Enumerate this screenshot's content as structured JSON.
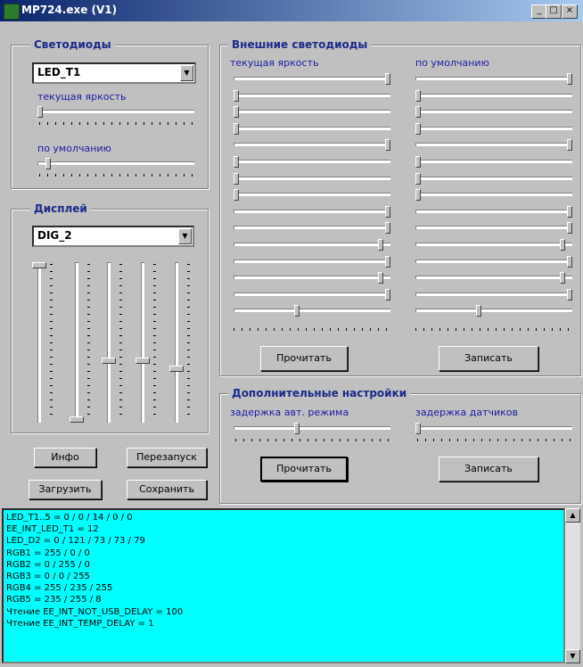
{
  "window": {
    "title": "MP724.exe (V1)",
    "controls": [
      "_",
      "□",
      "×"
    ]
  },
  "leds": {
    "title": "Светодиоды",
    "select_value": "LED_T1",
    "current_label": "текущая яркость",
    "current_value_fraction": 0.0,
    "default_label": "по умолчанию",
    "default_value_fraction": 0.05
  },
  "display": {
    "title": "Дисплей",
    "select_value": "DIG_2",
    "sliders_fraction": [
      0.0,
      1.0,
      0.62,
      0.62,
      0.67
    ]
  },
  "external": {
    "title": "Внешние светодиоды",
    "current_label": "текущая яркость",
    "default_label": "по умолчанию",
    "current_values_fraction": [
      1.0,
      0.0,
      0.0,
      0.0,
      1.0,
      0.0,
      0.0,
      0.0,
      1.0,
      1.0,
      0.95,
      1.0,
      0.95,
      1.0,
      0.4
    ],
    "default_values_fraction": [
      1.0,
      0.0,
      0.0,
      0.0,
      1.0,
      0.0,
      0.0,
      0.0,
      1.0,
      1.0,
      0.95,
      1.0,
      0.95,
      1.0,
      0.4
    ],
    "read_button": "Прочитать",
    "write_button": "Записать"
  },
  "extra": {
    "title": "Дополнительные настройки",
    "auto_delay_label": "задержка авт. режима",
    "auto_delay_fraction": 0.4,
    "sensor_delay_label": "задержка датчиков",
    "sensor_delay_fraction": 0.0,
    "read_button": "Прочитать",
    "write_button": "Записать"
  },
  "buttons": {
    "info": "Инфо",
    "restart": "Перезапуск",
    "load": "Загрузить",
    "save": "Сохранить"
  },
  "log_lines": [
    "LED_T1..5 = 0 / 0 / 14 / 0 / 0",
    "EE_INT_LED_T1 = 12",
    "LED_D2 = 0 / 121 / 73 / 73 / 79",
    "RGB1 = 255 / 0 / 0",
    "RGB2 = 0 / 255 / 0",
    "RGB3 = 0 / 0 / 255",
    "RGB4 = 255 / 235 / 255",
    "RGB5 = 235 / 255 / 8",
    "Чтение EE_INT_NOT_USB_DELAY = 100",
    "Чтение EE_INT_TEMP_DELAY = 1"
  ],
  "icons": {
    "app": "app-icon",
    "dropdown": "chevron-down-icon",
    "scroll_up": "arrow-up-icon",
    "scroll_down": "arrow-down-icon"
  }
}
